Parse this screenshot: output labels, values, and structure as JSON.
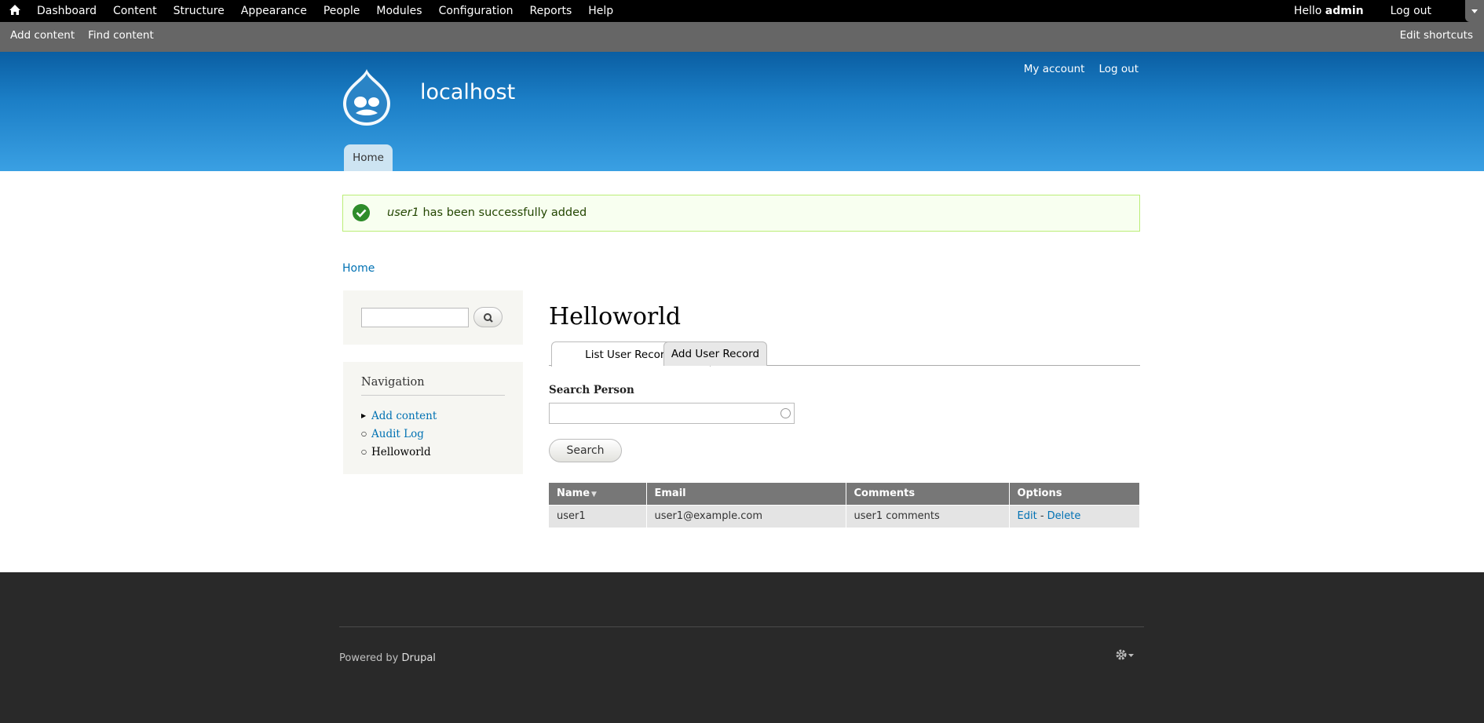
{
  "toolbar": {
    "menu": [
      "Dashboard",
      "Content",
      "Structure",
      "Appearance",
      "People",
      "Modules",
      "Configuration",
      "Reports",
      "Help"
    ],
    "hello_prefix": "Hello ",
    "username": "admin",
    "logout": "Log out"
  },
  "shortcuts": {
    "items": [
      "Add content",
      "Find content"
    ],
    "edit": "Edit shortcuts"
  },
  "header": {
    "site_name": "localhost",
    "secondary_menu": [
      "My account",
      "Log out"
    ],
    "main_menu_home": "Home"
  },
  "message": {
    "user": "user1",
    "text": " has been successfully added"
  },
  "breadcrumb": "Home",
  "sidebar": {
    "nav_title": "Navigation",
    "nav_items": [
      {
        "label": "Add content",
        "link": true
      },
      {
        "label": "Audit Log",
        "link": true
      },
      {
        "label": "Helloworld",
        "link": false
      }
    ]
  },
  "main": {
    "title": "Helloworld",
    "tabs": [
      "List User Records",
      "Add User Record"
    ],
    "search_label": "Search Person",
    "search_value": "",
    "search_button": "Search"
  },
  "table": {
    "headers": [
      "Name",
      "Email",
      "Comments",
      "Options"
    ],
    "rows": [
      {
        "name": "user1",
        "email": "user1@example.com",
        "comments": "user1 comments",
        "edit": "Edit",
        "sep": " - ",
        "delete": "Delete"
      }
    ]
  },
  "footer": {
    "powered_by": "Powered by ",
    "drupal": "Drupal"
  },
  "colors": {
    "toolbar": "#000000",
    "shortcut_bar": "#666666",
    "header_top": "#0a5ea2",
    "header_bottom": "#3aa0e3",
    "link": "#0071b3",
    "footer": "#292929",
    "status_border": "#bbee77"
  }
}
